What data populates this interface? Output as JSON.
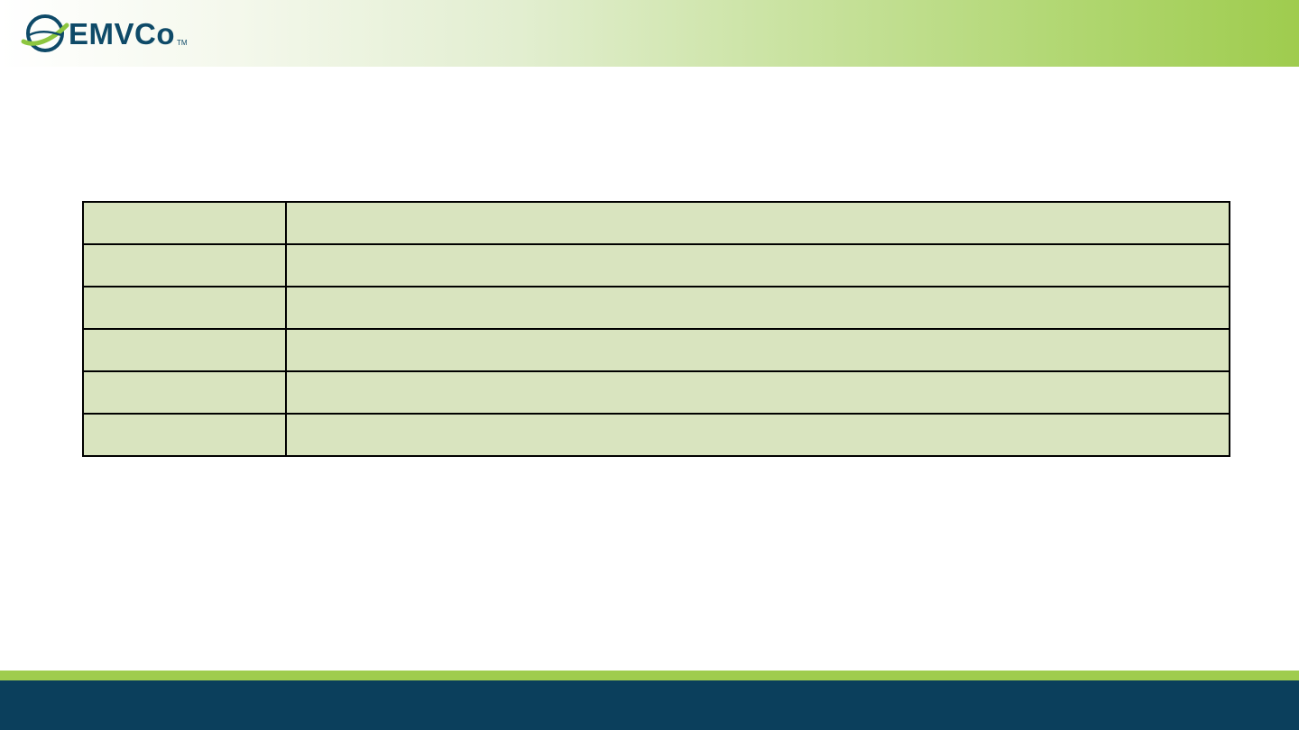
{
  "brand": {
    "name": "EMVCo",
    "trademark": "TM",
    "colors": {
      "navy": "#0b3f5c",
      "green": "#9fcc4e",
      "table_fill": "#d9e4bf"
    }
  },
  "table": {
    "rows": [
      [
        "",
        ""
      ],
      [
        "",
        ""
      ],
      [
        "",
        ""
      ],
      [
        "",
        ""
      ],
      [
        "",
        ""
      ],
      [
        "",
        ""
      ]
    ]
  }
}
